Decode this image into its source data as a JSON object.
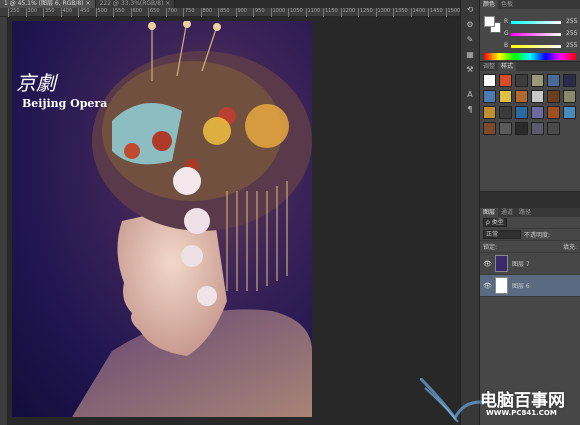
{
  "tabs": [
    {
      "label": "1 @ 45.1% (图层 6, RGB/8)",
      "close": "×"
    },
    {
      "label": "222 @ 33.3%(RGB/8)",
      "close": "×"
    }
  ],
  "ruler": {
    "ticks": [
      "250",
      "300",
      "350",
      "400",
      "450",
      "500",
      "550",
      "600",
      "650",
      "700",
      "750",
      "800",
      "850",
      "900",
      "950",
      "1000",
      "1050",
      "1100",
      "1150",
      "1200",
      "1250",
      "1300",
      "1350",
      "1400",
      "1450",
      "1500"
    ]
  },
  "artwork": {
    "title_chinese": "京劇",
    "title_english": "Beijing Opera"
  },
  "color_panel": {
    "tabs": [
      "颜色",
      "色板"
    ],
    "channels": [
      {
        "label": "R",
        "value": "255",
        "gradient": "#ff6666"
      },
      {
        "label": "G",
        "value": "255",
        "gradient": "#66ff66"
      },
      {
        "label": "B",
        "value": "255",
        "gradient": "#6666ff"
      }
    ],
    "foreground": "#ffffff",
    "background": "#ffffff"
  },
  "styles_panel": {
    "tabs": [
      "调整",
      "样式"
    ],
    "swatches": [
      "#ffffff",
      "#d94c2a",
      "#3c3c3c",
      "#9a9a7a",
      "#4a6a9a",
      "#2a2a4a",
      "#4a7ab0",
      "#e0c040",
      "#b06a30",
      "#c8c8c8",
      "#6a4020",
      "#8a8a6a",
      "#c09030",
      "#3a3a3a",
      "#2a6aa0",
      "#6a6aa0",
      "#a05020",
      "#4a8aba",
      "#7a4a2a",
      "#5a5a5a",
      "#2a2a2a",
      "#5a5a6a",
      "#4a4a4a"
    ]
  },
  "layers_panel": {
    "tabs": [
      "图层",
      "通道",
      "路径"
    ],
    "filter_label": "ρ 类型",
    "blend_mode": "正常",
    "opacity_label": "不透明度:",
    "lock_label": "锁定:",
    "fill_label": "填充:",
    "layers": [
      {
        "name": "图层 7",
        "selected": false,
        "thumb": "#3a2a6a"
      },
      {
        "name": "图层 6",
        "selected": true,
        "thumb": "#ffffff"
      }
    ]
  },
  "toolbar": {
    "icons": [
      "history-icon",
      "properties-icon",
      "brush-icon",
      "adjust-icon",
      "tool-preset-icon",
      "character-icon",
      "paragraph-icon"
    ],
    "glyphs": [
      "⟲",
      "⚙",
      "✎",
      "▦",
      "⚒",
      "A",
      "¶"
    ]
  },
  "watermark": {
    "text_cn": "电脑百事网",
    "url": "WWW.PC841.COM"
  }
}
